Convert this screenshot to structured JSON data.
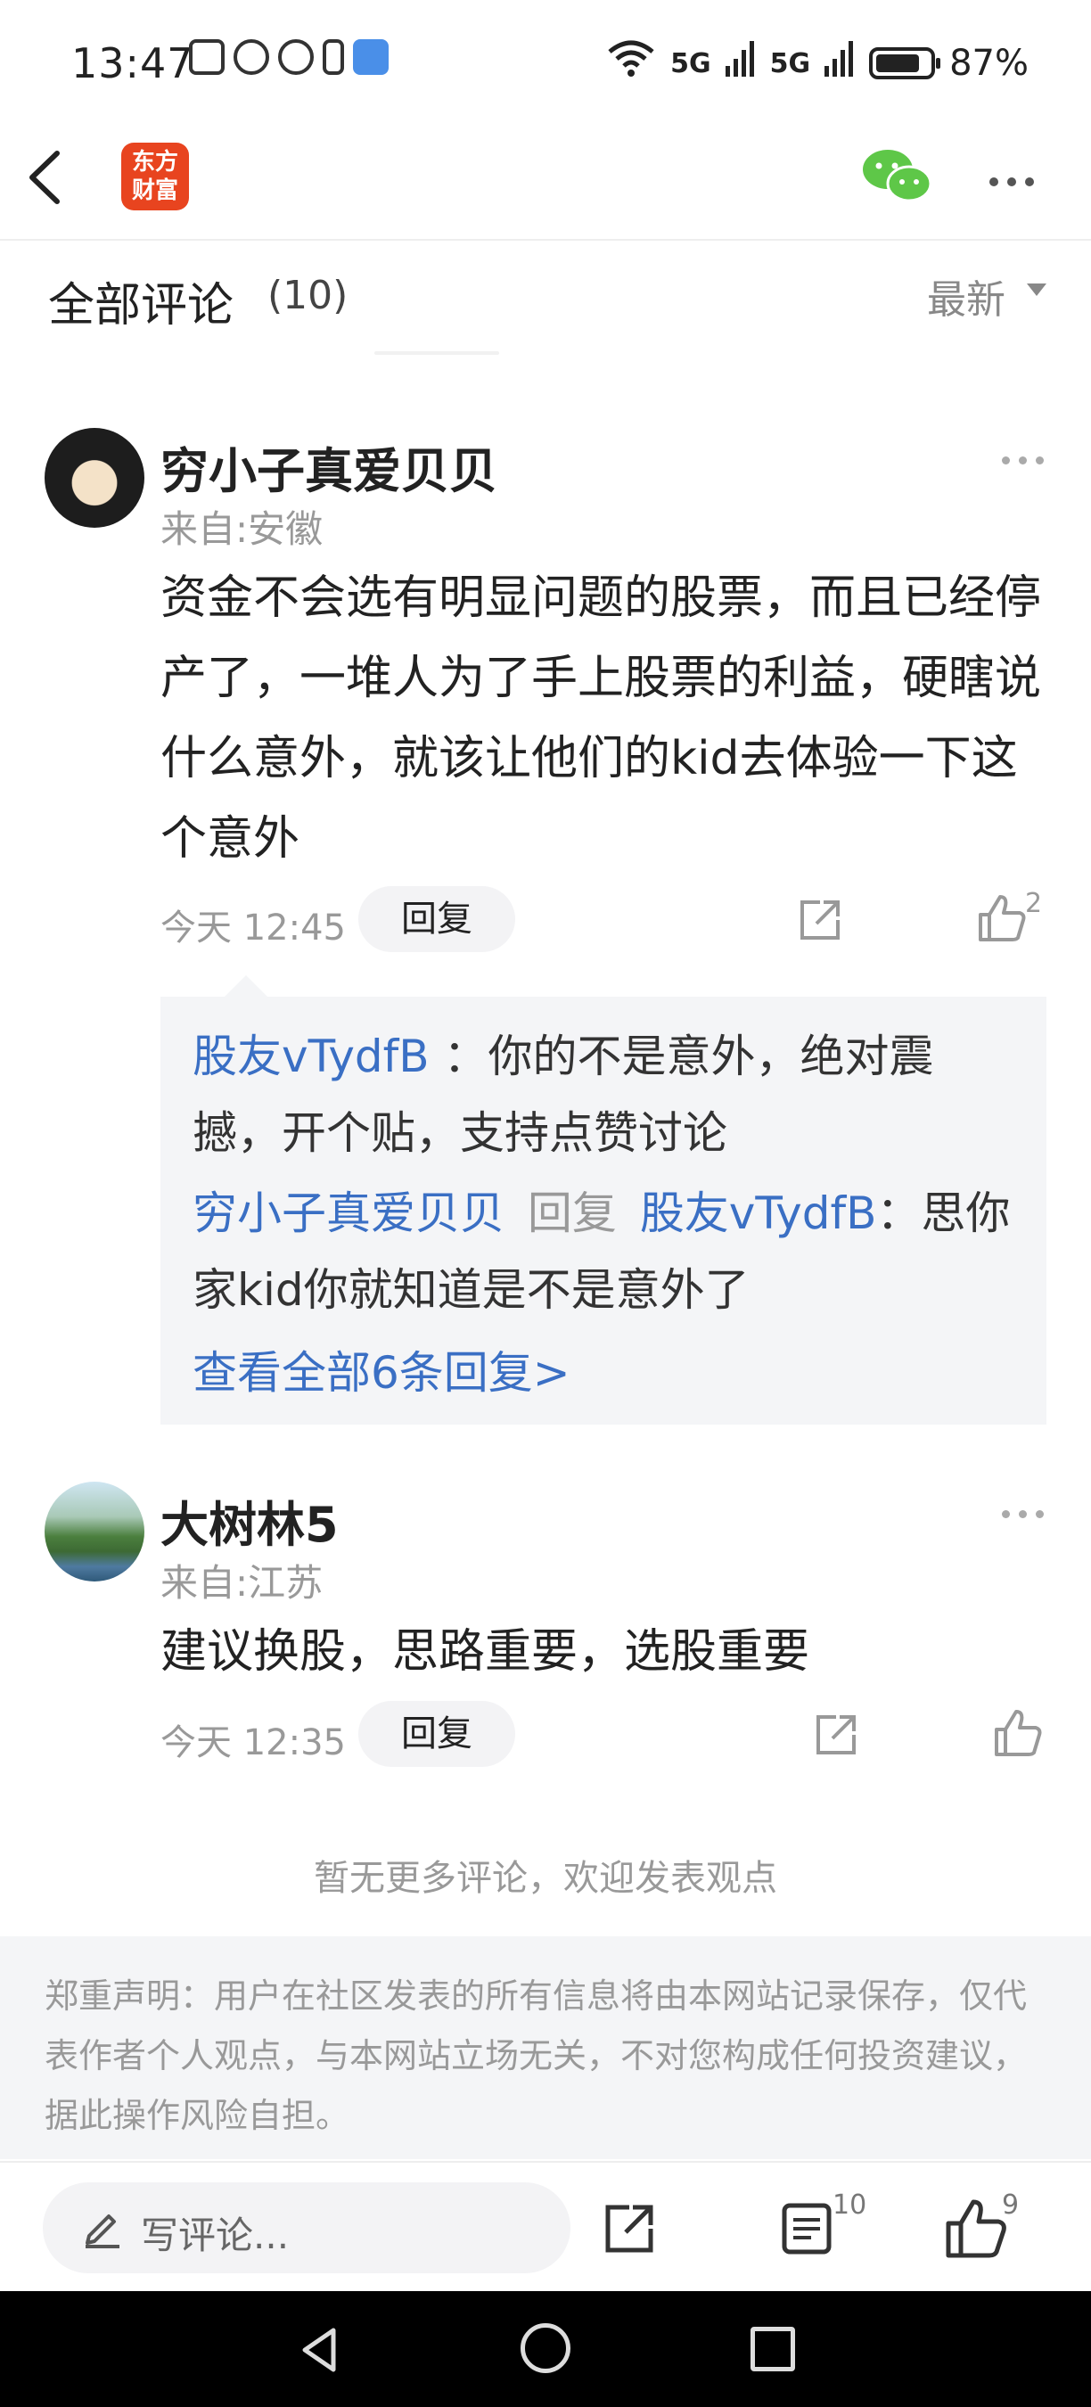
{
  "status_bar": {
    "time": "13:47",
    "network_label_1": "5G",
    "network_label_2": "5G",
    "battery": "87%"
  },
  "header": {
    "logo_text_line1": "东方",
    "logo_text_line2": "财富",
    "logo_color": "#e8441f"
  },
  "section": {
    "title": "全部评论",
    "count": "(10)",
    "sort_label": "最新"
  },
  "comments": [
    {
      "username": "穷小子真爱贝贝",
      "location": "来自:安徽",
      "content": "资金不会选有明显问题的股票，而且已经停产了，一堆人为了手上股票的利益，硬瞎说什么意外，就该让他们的kid去体验一下这个意外",
      "time": "今天 12:45",
      "reply_label": "回复",
      "like_count": "2",
      "replies": [
        {
          "user": "股友vTydfB",
          "sep": "：",
          "text": "你的不是意外，绝对震撼，开个贴，支持点赞讨论"
        },
        {
          "user": "穷小子真爱贝贝",
          "mid": "回复",
          "target": "股友vTydfB",
          "sep": "：",
          "text": "思你家kid你就知道是不是意外了"
        }
      ],
      "view_all": "查看全部6条回复>"
    },
    {
      "username": "大树林5",
      "location": "来自:江苏",
      "content": "建议换股，思路重要，选股重要",
      "time": "今天 12:35",
      "reply_label": "回复"
    }
  ],
  "no_more_text": "暂无更多评论，欢迎发表观点",
  "disclaimer": "郑重声明：用户在社区发表的所有信息将由本网站记录保存，仅代表作者个人观点，与本网站立场无关，不对您构成任何投资建议，据此操作风险自担。",
  "toolbar": {
    "comment_placeholder": "写评论...",
    "comment_count": "10",
    "like_count": "9"
  },
  "colors": {
    "link_blue": "#3a6fc4",
    "wechat_green": "#5ec748"
  }
}
